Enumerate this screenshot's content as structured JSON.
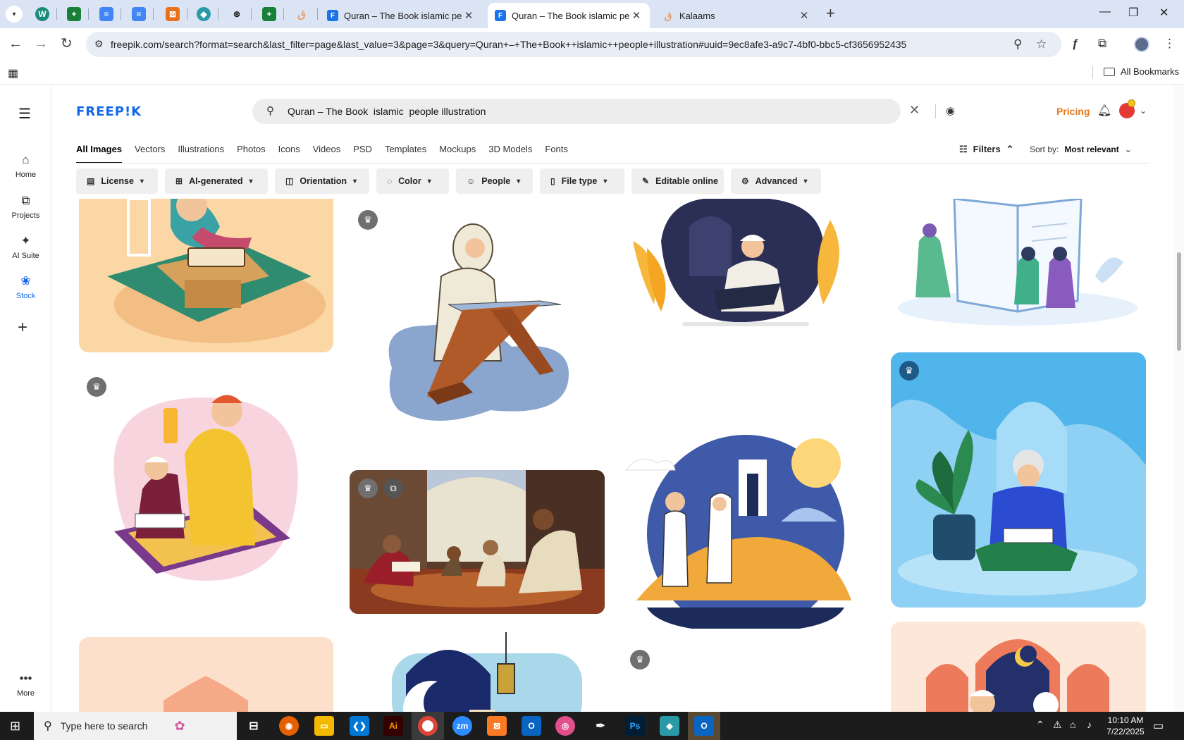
{
  "browser": {
    "tabs": [
      {
        "title": "Quran – The Book islamic peop",
        "active": false
      },
      {
        "title": "Quran – The Book islamic peop",
        "active": true
      },
      {
        "title": "Kalaams",
        "active": false
      }
    ],
    "url": "freepik.com/search?format=search&last_filter=page&last_value=3&page=3&query=Quran+–+The+Book++islamic++people+illustration#uuid=9ec8afe3-a9c7-4bf0-bbc5-cf3656952435",
    "bookmarks_label": "All Bookmarks"
  },
  "rail": {
    "items": [
      {
        "label": "Home",
        "icon": "home-icon"
      },
      {
        "label": "Projects",
        "icon": "projects-icon"
      },
      {
        "label": "AI Suite",
        "icon": "sparkle-icon"
      },
      {
        "label": "Stock",
        "icon": "stock-icon",
        "active": true
      }
    ],
    "more": "More"
  },
  "header": {
    "logo": "FREEP!K",
    "search_query": "Quran – The Book  islamic  people illustration",
    "pricing": "Pricing"
  },
  "categories": [
    "All Images",
    "Vectors",
    "Illustrations",
    "Photos",
    "Icons",
    "Videos",
    "PSD",
    "Templates",
    "Mockups",
    "3D Models",
    "Fonts"
  ],
  "active_category": "All Images",
  "filters_label": "Filters",
  "sort": {
    "label": "Sort by:",
    "value": "Most relevant"
  },
  "chips": [
    {
      "label": "License",
      "icon": "license-icon"
    },
    {
      "label": "AI-generated",
      "icon": "ai-icon"
    },
    {
      "label": "Orientation",
      "icon": "orientation-icon"
    },
    {
      "label": "Color",
      "icon": "palette-icon"
    },
    {
      "label": "People",
      "icon": "people-icon"
    },
    {
      "label": "File type",
      "icon": "file-icon"
    },
    {
      "label": "Editable online",
      "icon": "pen-icon"
    },
    {
      "label": "Advanced",
      "icon": "gear-icon"
    }
  ],
  "taskbar": {
    "search_placeholder": "Type here to search",
    "time": "10:10 AM",
    "date": "7/22/2025"
  },
  "colors": {
    "accent": "#1167e8",
    "pricing": "#e8791c"
  }
}
